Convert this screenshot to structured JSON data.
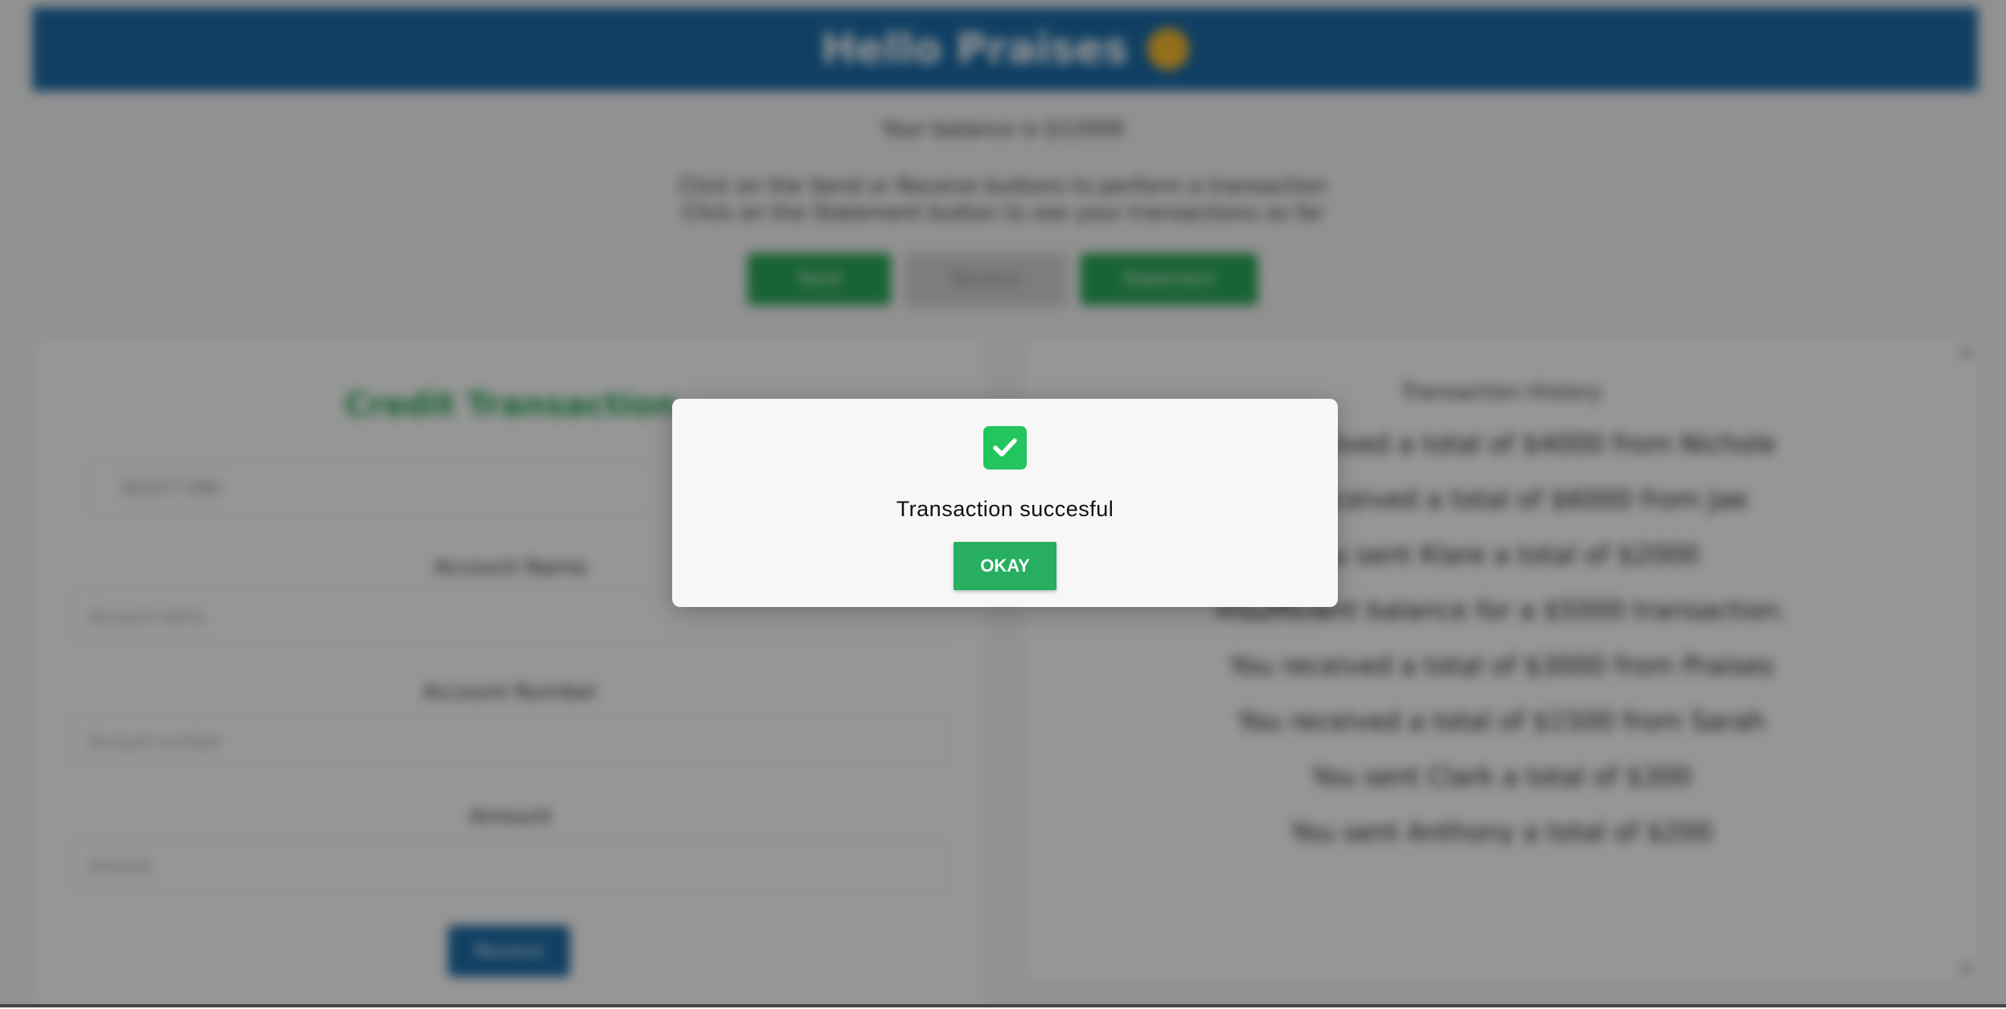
{
  "header": {
    "title": "Hello Praises"
  },
  "balance_text": "Your balance is $12000",
  "instructions": [
    "Click on the Send or Receive buttons to perform a transaction",
    "Click on the Statement button to see your transactions so far"
  ],
  "actions": {
    "send": "Send",
    "receive": "Receive",
    "statement": "Statement"
  },
  "form": {
    "title": "Credit Transaction",
    "select_value": "SELECT ONE",
    "account_name_label": "Account Name",
    "account_name_placeholder": "Account name",
    "account_number_label": "Account Number",
    "account_number_placeholder": "Account number",
    "amount_label": "Amount",
    "amount_placeholder": "Amount",
    "submit": "Receive"
  },
  "history": {
    "title": "Transaction History",
    "items": [
      "You received a total of $4000 from Nichole",
      "You received a total of $6000 from Jae",
      "You sent Klare a total of $2000",
      "Insufficient balance for a $5000 transaction.",
      "You received a total of $3000 from Praises",
      "You received a total of $1500 from Sarah",
      "You sent Clark a total of $300",
      "You sent Anthony a total of $200"
    ]
  },
  "modal": {
    "message": "Transaction succesful",
    "button": "OKAY"
  },
  "colors": {
    "header": "#1b6aa5",
    "success": "#27ae60",
    "check": "#22c55e"
  }
}
